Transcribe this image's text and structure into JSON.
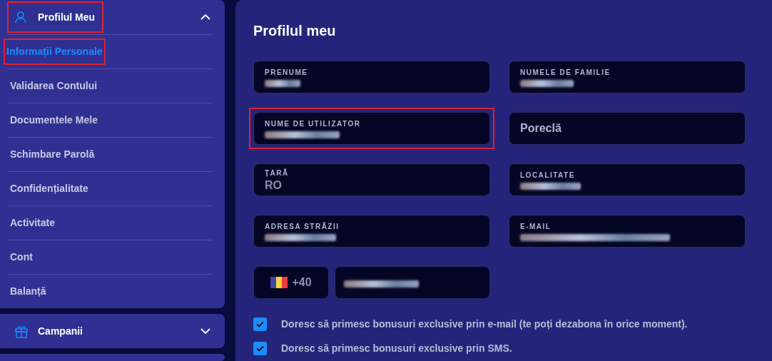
{
  "sidebar": {
    "sections": [
      {
        "kind": "profile",
        "label": "Profilul Meu",
        "expanded": true,
        "highlighted": true,
        "items": [
          {
            "label": "Informații Personale",
            "selected": true,
            "highlighted": true
          },
          {
            "label": "Validarea Contului",
            "selected": false,
            "highlighted": false
          },
          {
            "label": "Documentele Mele",
            "selected": false,
            "highlighted": false
          },
          {
            "label": "Schimbare Parolă",
            "selected": false,
            "highlighted": false
          },
          {
            "label": "Confidențialitate",
            "selected": false,
            "highlighted": false
          },
          {
            "label": "Activitate",
            "selected": false,
            "highlighted": false
          },
          {
            "label": "Cont",
            "selected": false,
            "highlighted": false
          },
          {
            "label": "Balanță",
            "selected": false,
            "highlighted": false
          }
        ]
      },
      {
        "kind": "gift",
        "label": "Campanii",
        "expanded": false,
        "highlighted": false
      }
    ]
  },
  "main": {
    "title": "Profilul meu",
    "fields": [
      {
        "label": "PRENUME",
        "redacted": true,
        "highlighted": false
      },
      {
        "label": "NUMELE DE FAMILIE",
        "redacted": true,
        "highlighted": false
      },
      {
        "label": "NUME DE UTILIZATOR",
        "redacted": true,
        "highlighted": true
      },
      {
        "placeholder": "Poreclă",
        "redacted": false,
        "highlighted": false
      },
      {
        "label": "ȚARĂ",
        "value": "RO",
        "redacted": false,
        "highlighted": false
      },
      {
        "label": "LOCALITATE",
        "redacted": true,
        "highlighted": false
      },
      {
        "label": "ADRESA STRĂZII",
        "redacted": true,
        "highlighted": false
      },
      {
        "label": "E-MAIL",
        "redacted": true,
        "highlighted": false
      }
    ],
    "phone": {
      "prefix": "+40",
      "redacted": true
    },
    "consents": [
      {
        "label": "Doresc să primesc bonusuri exclusive prin e-mail (te poți dezabona în orice moment).",
        "checked": true
      },
      {
        "label": "Doresc să primesc bonusuri exclusive prin SMS.",
        "checked": true
      }
    ]
  }
}
